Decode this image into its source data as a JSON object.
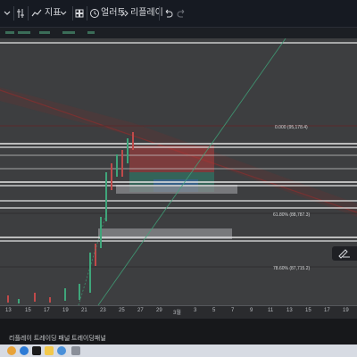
{
  "toolbar": {
    "indicators_label": "지표",
    "alert_label": "얼러트",
    "replay_label": "리플레이"
  },
  "chart": {
    "fib_levels": [
      {
        "label": "0.000 (95,178.4)"
      },
      {
        "label": "61.80% (88,787.3)"
      },
      {
        "label": "78.60% (87,715.2)"
      }
    ]
  },
  "dates": [
    "13",
    "15",
    "17",
    "19",
    "21",
    "23",
    "25",
    "27",
    "29",
    "3월",
    "3",
    "5",
    "7",
    "9",
    "11",
    "13",
    "15",
    "17",
    "19"
  ],
  "bottom_tabs": {
    "replay_panel": "리플레이 트레이딩 패널",
    "trading_panel": "트레이딩패널"
  },
  "colors": {
    "background": "#3d3e40",
    "white_line": "#e6e6e6",
    "green_trend": "#3fa57a",
    "red_zone": "#a02c2c"
  }
}
